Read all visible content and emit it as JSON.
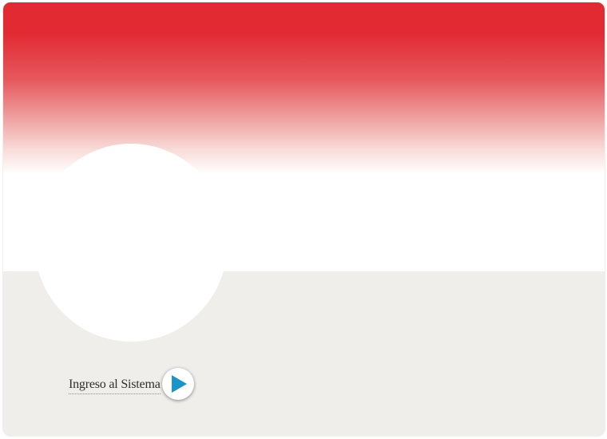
{
  "login": {
    "label": "Ingreso al Sistema",
    "icon": "play-arrow-icon",
    "icon_color": "#1a94c8"
  },
  "theme": {
    "header_red": "#e22a33",
    "background": "#efeeeb",
    "white": "#ffffff"
  }
}
